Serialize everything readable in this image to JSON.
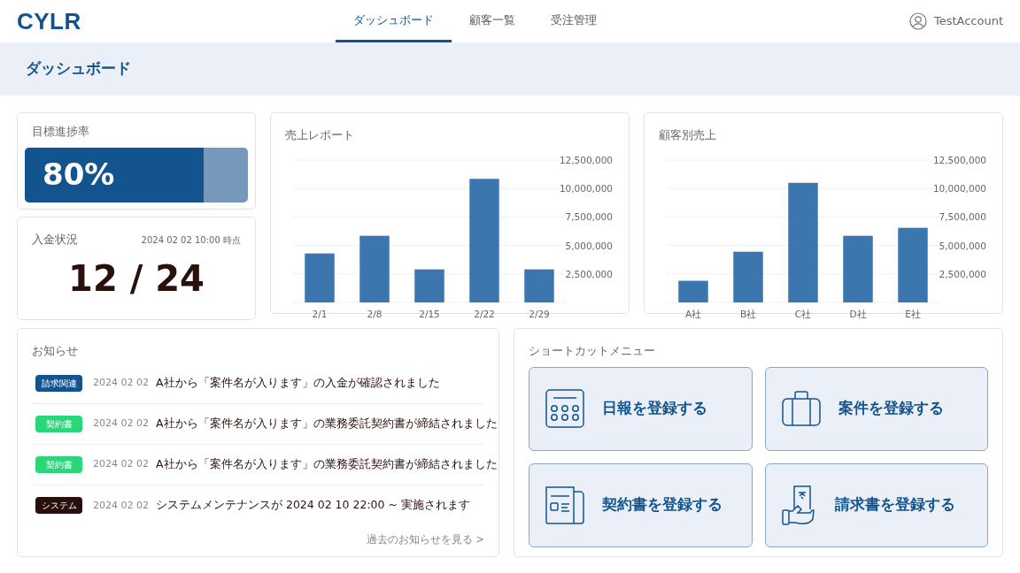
{
  "brand": "CYLR",
  "tabs": [
    {
      "label": "ダッシュボード",
      "selected": true
    },
    {
      "label": "顧客一覧",
      "selected": false
    },
    {
      "label": "受注管理",
      "selected": false
    }
  ],
  "user": {
    "name": "TestAccount"
  },
  "page_title": "ダッシュボード",
  "progress": {
    "title": "目標進捗率",
    "level": 0.8,
    "reading": "80%"
  },
  "payment": {
    "title": "入金状況",
    "timestamp": "2024 02 02 10:00 時点",
    "value": "12 / 24"
  },
  "sales_report": {
    "title": "売上レポート",
    "chart_data": {
      "type": "bar",
      "categories": [
        "2/1",
        "2/8",
        "2/15",
        "2/22",
        "2/29"
      ],
      "grid": true,
      "series": [
        {
          "color": "#3b76ae",
          "values": [
            4300000,
            5850000,
            2900000,
            10850000,
            2900000
          ]
        }
      ],
      "ylim": [
        0,
        12500000
      ],
      "yticks": [
        {
          "value": 2500000,
          "label": "2,500,000"
        },
        {
          "value": 5000000,
          "label": "5,000,000"
        },
        {
          "value": 7500000,
          "label": "7,500,000"
        },
        {
          "value": 10000000,
          "label": "10,000,000"
        },
        {
          "value": 12500000,
          "label": "12,500,000"
        }
      ]
    }
  },
  "customer_sales": {
    "title": "顧客別売上",
    "chart_data": {
      "type": "bar",
      "categories": [
        "A社",
        "B社",
        "C社",
        "D社",
        "E社"
      ],
      "grid": true,
      "series": [
        {
          "color": "#3b76ae",
          "values": [
            1900000,
            4450000,
            10500000,
            5850000,
            6550000
          ]
        }
      ],
      "ylim": [
        0,
        12500000
      ],
      "yticks": [
        {
          "value": 2500000,
          "label": "2,500,000"
        },
        {
          "value": 5000000,
          "label": "5,000,000"
        },
        {
          "value": 7500000,
          "label": "7,500,000"
        },
        {
          "value": 10000000,
          "label": "10,000,000"
        },
        {
          "value": 12500000,
          "label": "12,500,000"
        }
      ]
    }
  },
  "notices": {
    "title": "お知らせ",
    "items": [
      {
        "tag": "請求関連",
        "color": "#13548f",
        "date": "2024 02 02",
        "text": "A社から「案件名が入ります」の入金が確認されました"
      },
      {
        "tag": "契約書",
        "color": "#2bd67b",
        "date": "2024 02 02",
        "text": "A社から「案件名が入ります」の業務委託契約書が締結されました"
      },
      {
        "tag": "契約書",
        "color": "#2bd67b",
        "date": "2024 02 02",
        "text": "A社から「案件名が入ります」の業務委託契約書が締結されました"
      },
      {
        "tag": "システム",
        "color": "#2a100c",
        "date": "2024 02 02",
        "text": "システムメンテナンスが 2024 02 10 22:00 ~ 実施されます"
      }
    ],
    "more_link": "過去のお知らせを見る >"
  },
  "shortcuts": {
    "title": "ショートカットメニュー",
    "items": [
      {
        "kind": "calendar",
        "label": "日報を登録する"
      },
      {
        "kind": "briefcase",
        "label": "案件を登録する"
      },
      {
        "kind": "document",
        "label": "契約書を登録する"
      },
      {
        "kind": "invoice",
        "label": "請求書を登録する"
      }
    ]
  }
}
